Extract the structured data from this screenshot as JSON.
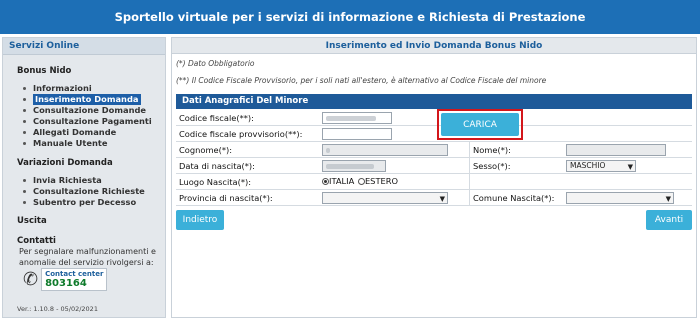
{
  "header": {
    "title": "Sportello virtuale per i servizi di informazione e Richiesta di Prestazione"
  },
  "sidebar": {
    "title": "Servizi Online",
    "section1": {
      "title": "Bonus Nido",
      "items": [
        {
          "label": "Informazioni"
        },
        {
          "label": "Inserimento Domanda"
        },
        {
          "label": "Consultazione Domande"
        },
        {
          "label": "Consultazione Pagamenti"
        },
        {
          "label": "Allegati Domande"
        },
        {
          "label": "Manuale Utente"
        }
      ]
    },
    "section2": {
      "title": "Variazioni Domanda",
      "items": [
        {
          "label": "Invia Richiesta"
        },
        {
          "label": "Consultazione Richieste"
        },
        {
          "label": "Subentro per Decesso"
        }
      ]
    },
    "exit": "Uscita",
    "contacts": {
      "title": "Contatti",
      "text1": "Per segnalare malfunzionamenti e",
      "text2": "anomalie del servizio rivolgersi a:",
      "contact_center_label": "Contact center",
      "contact_center_number": "803164"
    },
    "version": "Ver.: 1.10.8 - 05/02/2021"
  },
  "main": {
    "title": "Inserimento ed Invio Domanda Bonus Nido",
    "note1": "(*) Dato Obbligatorio",
    "note2": "(**) Il Codice Fiscale Provvisorio, per i soli nati all'estero, è alternativo al Codice Fiscale del minore",
    "form_title": "Dati Anagrafici Del Minore",
    "fields": {
      "codice_fiscale": "Codice fiscale(**):",
      "codice_provvisorio": "Codice fiscale provvisorio(**):",
      "cognome": "Cognome(*):",
      "nome": "Nome(*):",
      "data_nascita": "Data di nascita(*):",
      "sesso": "Sesso(*):",
      "sesso_value": "MASCHIO",
      "luogo_nascita": "Luogo Nascita(*):",
      "radio_italia": "ITALIA",
      "radio_estero": "ESTERO",
      "provincia": "Provincia di nascita(*):",
      "comune": "Comune Nascita(*):"
    },
    "buttons": {
      "carica": "CARICA",
      "indietro": "Indietro",
      "avanti": "Avanti"
    }
  },
  "colors": {
    "header_bg": "#1d6fb6",
    "button": "#3bb0d9",
    "highlight": "#d3161b",
    "form_header": "#1e5a99"
  }
}
